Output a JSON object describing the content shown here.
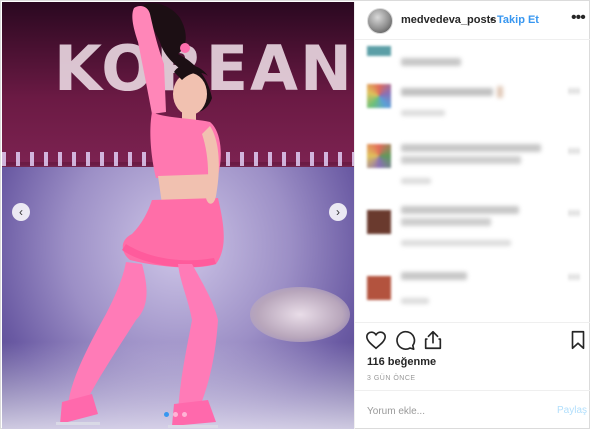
{
  "post": {
    "image_alt_logo": "KOREAN",
    "carousel": {
      "slides": 3,
      "active_index": 0
    }
  },
  "header": {
    "username": "medvedeva_posts",
    "separator": "•",
    "follow_label": "Takip Et",
    "more_icon": "ellipsis-icon"
  },
  "comments": {
    "note": "",
    "rows": [
      {
        "avatar_color": "#5b9ea6"
      },
      {
        "avatar_color": "#8a6fb6"
      },
      {
        "avatar_color": "#5d9a5a"
      },
      {
        "avatar_color": "#6a3a2e"
      },
      {
        "avatar_color": "#b3533e"
      }
    ]
  },
  "actions": {
    "like_icon": "heart-icon",
    "comment_icon": "comment-icon",
    "share_icon": "share-icon",
    "save_icon": "bookmark-icon",
    "likes_text": "116 beğenme",
    "time_text": "3 GÜN ÖNCE"
  },
  "comment_form": {
    "placeholder": "Yorum ekle...",
    "submit_label": "Paylaş"
  },
  "colors": {
    "accent": "#3897f0",
    "text": "#262626",
    "muted": "#999999",
    "border": "#efefef"
  }
}
